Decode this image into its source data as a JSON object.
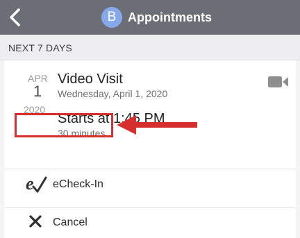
{
  "header": {
    "avatar_letter": "B",
    "title": "Appointments",
    "back_icon": "chevron-left-icon"
  },
  "section": {
    "label": "NEXT 7 DAYS"
  },
  "appointment": {
    "month": "APR",
    "day": "1",
    "year": "2020",
    "type": "Video Visit",
    "full_date": "Wednesday, April 1, 2020",
    "start_time": "Starts at 1:45 PM",
    "duration": "30 minutes",
    "type_icon": "video-camera-icon"
  },
  "actions": {
    "echeckin_label": "eCheck-In",
    "echeckin_icon": "echeckin-icon",
    "cancel_label": "Cancel",
    "cancel_icon": "close-icon"
  },
  "colors": {
    "topbar": "#6b6e74",
    "avatar": "#87a9e9",
    "highlight": "#d72e2e"
  }
}
